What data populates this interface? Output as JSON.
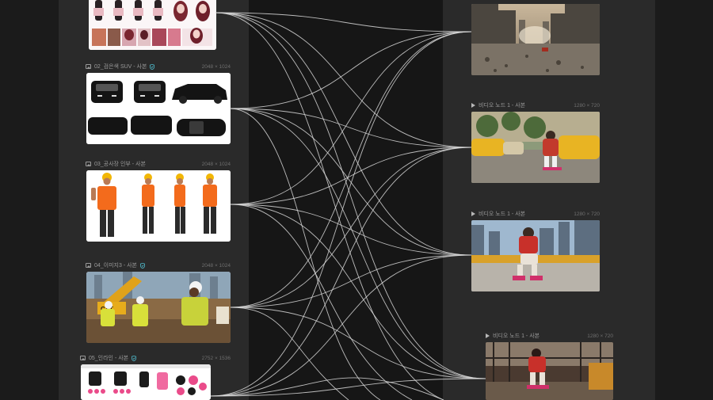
{
  "left_nodes": [
    {
      "title": "",
      "dims": ""
    },
    {
      "title": "02_검은색 SUV - 사본",
      "dims": "2048 × 1024"
    },
    {
      "title": "03_공사장 인부 - 사본",
      "dims": "2048 × 1024"
    },
    {
      "title": "04_이미지3 - 사본",
      "dims": "2048 × 1024"
    },
    {
      "title": "05_인라인 - 사본",
      "dims": "2752 × 1536"
    }
  ],
  "right_nodes": [
    {
      "title": "",
      "dims": ""
    },
    {
      "title": "비디오 노드 1 - 사본",
      "dims": "1280 × 720"
    },
    {
      "title": "비디오 노드 1 - 사본",
      "dims": "1280 × 720"
    },
    {
      "title": "비디오 노드 1 - 사본",
      "dims": "1280 × 720"
    }
  ],
  "colors": {
    "background": "#1b1b1b",
    "panel": "#2a2a2a",
    "connector": "#d9d9d9",
    "badge": "#4fb8c9"
  },
  "icons": [
    "image-icon",
    "play-icon",
    "shield-check-icon"
  ]
}
